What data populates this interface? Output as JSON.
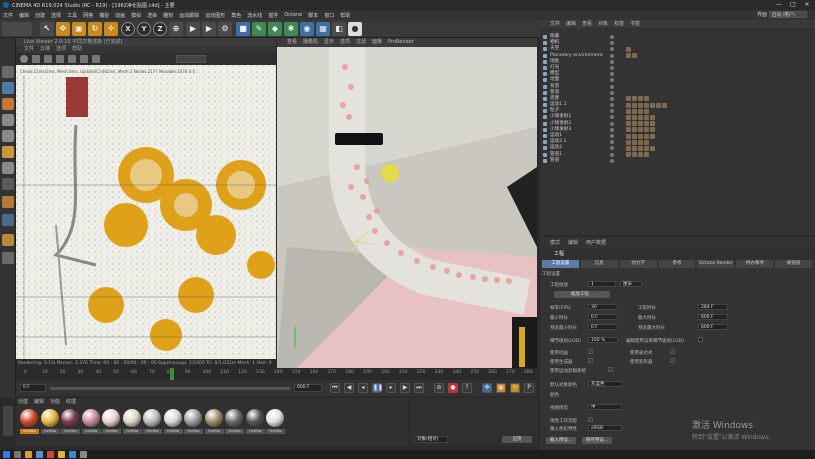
{
  "window": {
    "title": "CINEMA 4D R19.024 Studio (RC - R19) - [1962净化贴图.c4d] - 主要",
    "min": "—",
    "max": "□",
    "close": "✕"
  },
  "menubar": {
    "items": [
      "文件",
      "编辑",
      "创建",
      "选择",
      "工具",
      "网格",
      "捕捉",
      "动画",
      "模拟",
      "渲染",
      "雕刻",
      "运动跟踪",
      "运动图形",
      "角色",
      "流水线",
      "插件",
      "Octane",
      "脚本",
      "窗口",
      "帮助"
    ],
    "layout_label": "界面",
    "layout_value": "启动 (用户)"
  },
  "toolbar": {
    "axis_x": "X",
    "axis_y": "Y",
    "axis_z": "Z"
  },
  "left_viewport": {
    "tab": "Live Viewer 2.0-10 不同方格渲染 (已完成)",
    "menus": [
      "文件",
      "云端",
      "选项",
      "帮助"
    ],
    "info": "Check:11ms/2ms, Mesh:0ms, Update[C]:462ms, Mesh:1 Nodes:2177 Movable:1076 0 0",
    "status": "Rendering: 0.1%   Ms/sec: 2.276   Time: 00 : 00 : 00/00 : 00 : 00   Spp/maxspp: 1/1000   Tri: 0/1.031m   Mesh: 1   Hair: 0"
  },
  "right_viewport": {
    "menus": [
      "查看",
      "摄像机",
      "显示",
      "选项",
      "过滤",
      "面板",
      "ProRender"
    ]
  },
  "object_manager": {
    "tabs": [
      "文件",
      "编辑",
      "查看",
      "对象",
      "标签",
      "书签"
    ],
    "rows": [
      {
        "name": "隐藏",
        "tags": 0
      },
      {
        "name": "相机",
        "tags": 0
      },
      {
        "name": "天空",
        "tags": 1
      },
      {
        "name": "Planetary environment",
        "tags": 2
      },
      {
        "name": "地板",
        "tags": 0
      },
      {
        "name": "灯光",
        "tags": 0
      },
      {
        "name": "模型",
        "tags": 0
      },
      {
        "name": "地面",
        "tags": 0
      },
      {
        "name": "背景",
        "tags": 0
      },
      {
        "name": "管道",
        "tags": 0
      },
      {
        "name": "克隆",
        "tags": 4
      },
      {
        "name": "运动1.1",
        "tags": 7
      },
      {
        "name": "粒子",
        "tags": 4
      },
      {
        "name": "小球发射1",
        "tags": 5
      },
      {
        "name": "小球发射2",
        "tags": 5
      },
      {
        "name": "小球发射3",
        "tags": 5
      },
      {
        "name": "运动1",
        "tags": 5
      },
      {
        "name": "运动2.1",
        "tags": 4
      },
      {
        "name": "运动2",
        "tags": 5
      },
      {
        "name": "管道1",
        "tags": 4
      },
      {
        "name": "管道",
        "tags": 0
      }
    ]
  },
  "attribute_manager": {
    "tabs": [
      "模式",
      "编辑",
      "用户数据"
    ],
    "title": "工程",
    "section_buttons": [
      "工程设置",
      "信息",
      "动力学",
      "参考",
      "Octane Render",
      "待办事项",
      "帧插值"
    ],
    "section": "工程设置",
    "scale_label": "工程缩放",
    "scale_value": "1",
    "scale_unit": "厘米",
    "scale_button": "缩放工程...",
    "fps_label": "帧率(FPS)",
    "fps_value": "30",
    "min_time_label": "最小时长",
    "min_time_value": "0 F",
    "preview_min_label": "预览最小时长",
    "preview_min_value": "0 F",
    "time_label": "工程时长",
    "time_value": "284 F",
    "max_time_label": "最大时长",
    "max_time_value": "600 F",
    "preview_max_label": "预览最大时长",
    "preview_max_value": "600 F",
    "lod_label": "细节级别(LOD)",
    "lod_value": "100 %",
    "render_lod_label": "编辑使用渲染细节级别(LOD)",
    "anim_label": "使用动画",
    "expr_label": "使用表达式",
    "gen_label": "使用生成器",
    "deform_label": "使用变形器",
    "motion_label": "使用运动剪辑系统",
    "color_label": "默认对象颜色",
    "color_value": "灰蓝色",
    "colorval_label": "颜色",
    "view_clip_label": "视图修剪",
    "view_clip_value": "中",
    "linear_label": "线性工作流程",
    "input_color_label": "输入色彩特性",
    "input_color_value": "sRGB",
    "load_btn": "载入预设...",
    "save_btn": "保存预设..."
  },
  "timeline": {
    "ticks": [
      "0",
      "10",
      "20",
      "30",
      "40",
      "50",
      "60",
      "70",
      "80",
      "90",
      "100",
      "110",
      "120",
      "130",
      "140",
      "150",
      "160",
      "170",
      "180",
      "190",
      "200",
      "210",
      "220",
      "230",
      "240",
      "250",
      "260",
      "270",
      "280"
    ],
    "current_frame": "0 F",
    "end_frame": "600 F",
    "start_field": "0 F"
  },
  "material_manager": {
    "menus": [
      "创建",
      "编辑",
      "功能",
      "纹理"
    ],
    "materials": [
      {
        "name": "OctGlo",
        "color": "#d24a2a",
        "selected": true
      },
      {
        "name": "OctGlo",
        "color": "#e6b53c",
        "selected": false
      },
      {
        "name": "OctGlo",
        "color": "#7a3a52",
        "selected": false
      },
      {
        "name": "OctGlo",
        "color": "#c98a9a",
        "selected": false
      },
      {
        "name": "OctGlo",
        "color": "#e8d2cf",
        "selected": false
      },
      {
        "name": "OctGlo",
        "color": "#ddd5c5",
        "selected": false
      },
      {
        "name": "OctGlo",
        "color": "#bbbbbb",
        "selected": false
      },
      {
        "name": "OctGlo",
        "color": "#d8d8d8",
        "selected": false
      },
      {
        "name": "OctGlo",
        "color": "#9a9a9a",
        "selected": false
      },
      {
        "name": "OctGlo",
        "color": "#a08a62",
        "selected": false
      },
      {
        "name": "OctGlo",
        "color": "#6a6a6a",
        "selected": false
      },
      {
        "name": "OctGlo",
        "color": "#555555",
        "selected": false
      },
      {
        "name": "OctGlo",
        "color": "#e0e0e0",
        "selected": false
      }
    ]
  },
  "coords": {
    "apply": "应用",
    "mode": "对象(相对)"
  },
  "watermark": {
    "line1": "激活 Windows",
    "line2": "转到\"设置\"以激活 Windows。"
  },
  "colors": {
    "accent": "#c87818",
    "panel": "#333333",
    "active_tab": "#5a7aa8"
  }
}
